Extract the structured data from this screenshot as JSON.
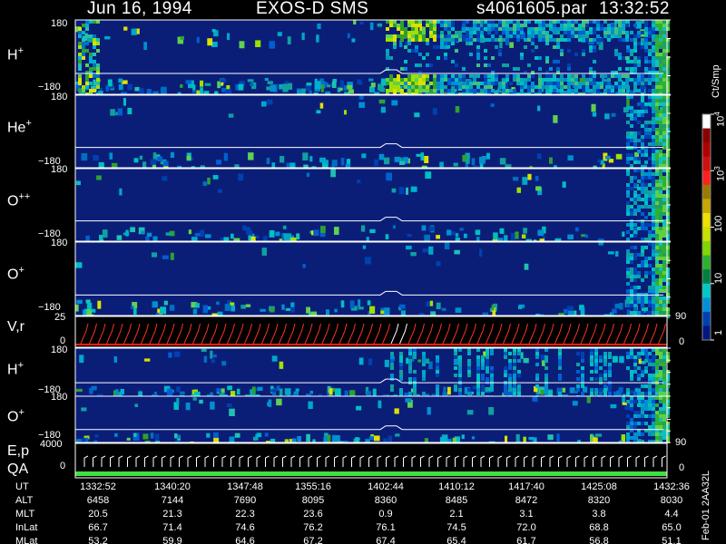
{
  "header": {
    "date": "Jun 16, 1994",
    "mission": "EXOS-D SMS",
    "file": "s4061605.par",
    "time": "13:32:52"
  },
  "colorbar": {
    "unit": "Ct/Smp",
    "ticks": [
      {
        "label": "1",
        "level": 0.0
      },
      {
        "label": "10",
        "level": 0.25
      },
      {
        "label": "100",
        "level": 0.5
      },
      {
        "label": "10",
        "sup": "3",
        "level": 0.75
      },
      {
        "label": "10",
        "sup": "4",
        "level": 1.0
      }
    ],
    "colors": [
      "#ffffff",
      "#8b0000",
      "#b00000",
      "#d01010",
      "#ff2020",
      "#9a7a00",
      "#c8a800",
      "#f0e000",
      "#c8e000",
      "#80d800",
      "#30b030",
      "#008040",
      "#00c8c8",
      "#0090d8",
      "#0040b0",
      "#001880"
    ]
  },
  "panels": [
    {
      "id": "h-plus",
      "species": "H",
      "charge": "+",
      "ylim_top": "180",
      "ylim_bot": "−180"
    },
    {
      "id": "he-plus",
      "species": "He",
      "charge": "+",
      "ylim_top": "180",
      "ylim_bot": "−180"
    },
    {
      "id": "o-plusplus",
      "species": "O",
      "charge": "++",
      "ylim_top": "180",
      "ylim_bot": "−180"
    },
    {
      "id": "o-plus",
      "species": "O",
      "charge": "+",
      "ylim_top": "180",
      "ylim_bot": "−180"
    },
    {
      "id": "vr",
      "species": "V,r",
      "charge": "",
      "ylim_top": "25",
      "ylim_bot": "0",
      "right_top": "90",
      "right_bot": "0"
    },
    {
      "id": "h-plus-2",
      "species": "H",
      "charge": "+",
      "ylim_top": "180",
      "ylim_bot": "−180"
    },
    {
      "id": "o-plus-2",
      "species": "O",
      "charge": "+",
      "ylim_top": "180",
      "ylim_bot": "−180"
    },
    {
      "id": "ep-qa",
      "species": "E,p",
      "species2": "QA",
      "charge": "",
      "ylim_top": "4000",
      "ylim_bot": "0",
      "right_top": "90",
      "right_bot": "0"
    }
  ],
  "stats": {
    "rows": [
      {
        "label": "UT",
        "values": [
          "1332:52",
          "1340:20",
          "1347:48",
          "1355:16",
          "1402:44",
          "1410:12",
          "1417:40",
          "1425:08",
          "1432:36"
        ]
      },
      {
        "label": "ALT",
        "values": [
          "6458",
          "7144",
          "7690",
          "8095",
          "8360",
          "8485",
          "8472",
          "8320",
          "8030"
        ]
      },
      {
        "label": "MLT",
        "values": [
          "20.5",
          "21.3",
          "22.3",
          "23.6",
          "0.9",
          "2.1",
          "3.1",
          "3.8",
          "4.4"
        ]
      },
      {
        "label": "InLat",
        "values": [
          "66.7",
          "71.4",
          "74.6",
          "76.2",
          "76.1",
          "74.5",
          "72.0",
          "68.8",
          "65.0"
        ]
      },
      {
        "label": "MLat",
        "values": [
          "53.2",
          "59.9",
          "64.6",
          "67.2",
          "67.4",
          "65.4",
          "61.7",
          "56.8",
          "51.1"
        ]
      }
    ],
    "footer": "Feb-01 2AA32L"
  }
}
